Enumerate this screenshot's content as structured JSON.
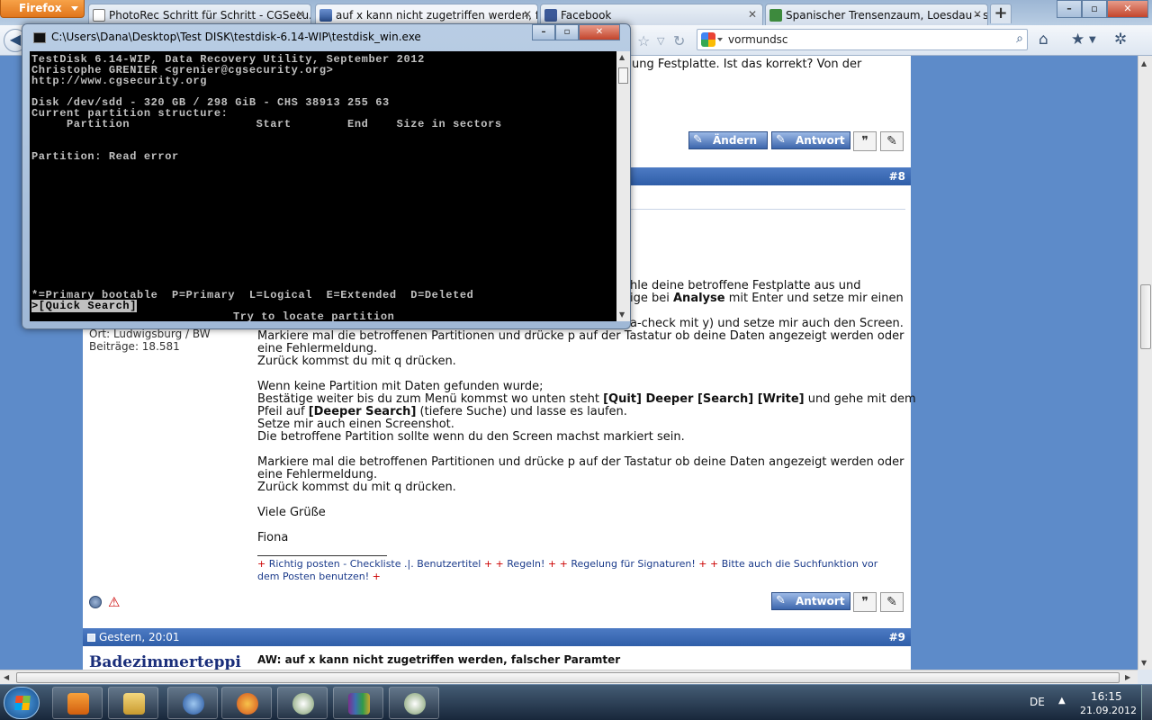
{
  "browser": {
    "menu_button": "Firefox",
    "tabs": [
      {
        "label": "PhotoRec Schritt für Schritt - CGSecu...",
        "icon": "photorec-icon",
        "active": false
      },
      {
        "label": "auf x kann nicht zugetriffen werden, f...",
        "icon": "page-icon",
        "active": true
      },
      {
        "label": "Facebook",
        "icon": "facebook-icon",
        "active": false
      },
      {
        "label": "Spanischer Trensenzaum, Loesdau - s...",
        "icon": "page-icon",
        "active": false
      }
    ],
    "new_tab": "+",
    "search_value": "vormundsc",
    "window_controls": {
      "minimize": "–",
      "maximize": "▫",
      "close": "✕"
    }
  },
  "cmd_window": {
    "title": "C:\\Users\\Dana\\Desktop\\Test DISK\\testdisk-6.14-WIP\\testdisk_win.exe",
    "lines": [
      "TestDisk 6.14-WIP, Data Recovery Utility, September 2012",
      "Christophe GRENIER <grenier@cgsecurity.org>",
      "http://www.cgsecurity.org",
      "",
      "Disk /dev/sdd - 320 GB / 298 GiB - CHS 38913 255 63",
      "Current partition structure:",
      "     Partition                  Start        End    Size in sectors",
      "",
      "",
      "Partition: Read error"
    ],
    "legend": "*=Primary bootable  P=Primary  L=Logical  E=Extended  D=Deleted",
    "selected_option": ">[Quick Search]",
    "hint": "Try to locate partition"
  },
  "forum": {
    "top_text": "ung Festplatte. Ist das korrekt? Von der",
    "post8_number": "#8",
    "edit_button": "Ändern",
    "reply_button": "Antwort",
    "post_lines_partial": [
      "hle deine betroffene Festplatte aus und",
      "ige bei <b>Analyse</b> mit Enter und setze mir einen",
      "a-check mit y) und setze mir auch den Screen."
    ],
    "location": "Ort: Ludwigsburg / BW",
    "posts_count": "Beiträge: 18.581",
    "body_lines": [
      "Markiere mal die betroffenen Partitionen und drücke p auf der Tastatur ob deine Daten angezeigt werden oder",
      "eine Fehlermeldung.",
      "Zurück kommst du mit q drücken.",
      "",
      "Wenn keine Partition mit Daten gefunden wurde;",
      "Bestätige weiter bis du zum Menü kommst wo unten steht <b>[Quit] Deeper [Search] [Write]</b> und gehe mit dem",
      "Pfeil auf <b>[Deeper Search]</b> (tiefere Suche) und lasse es laufen.",
      "Setze mir auch einen Screenshot.",
      "Die betroffene Partition sollte wenn du den Screen machst markiert sein.",
      "",
      "Markiere mal die betroffenen Partitionen und drücke p auf der Tastatur ob deine Daten angezeigt werden oder",
      "eine Fehlermeldung.",
      "Zurück kommst du mit q drücken.",
      "",
      "Viele Grüße",
      "",
      "Fiona"
    ],
    "signature_line1": [
      "+",
      " Richtig posten - Checkliste .|. Benutzertitel ",
      "+ +",
      " Regeln! ",
      "+ +",
      " Regelung für Signaturen! ",
      "+ +",
      " Bitte auch die Suchfunktion vor"
    ],
    "signature_line2": [
      "dem Posten benutzen! ",
      "+"
    ],
    "post9_time": "Gestern, 20:01",
    "post9_number": "#9",
    "post9_user": "Badezimmerteppi",
    "post9_title": "AW: auf x kann nicht zugetriffen werden, falscher Paramter"
  },
  "taskbar": {
    "language": "DE",
    "time": "16:15",
    "date": "21.09.2012",
    "apps": [
      "media-player",
      "explorer",
      "thunderbird",
      "firefox",
      "testdisk-search",
      "winrar",
      "testdisk-search-2"
    ]
  }
}
